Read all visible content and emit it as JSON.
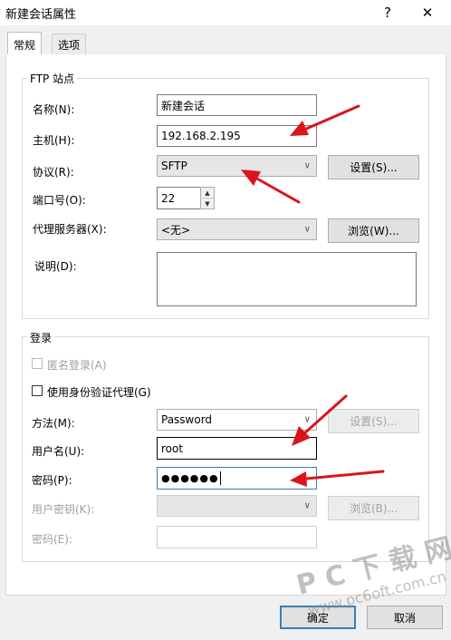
{
  "window": {
    "title": "新建会话属性",
    "help_label": "?",
    "close_label": "✕"
  },
  "tabs": [
    {
      "label": "常规"
    },
    {
      "label": "选项"
    }
  ],
  "ftp_group": {
    "legend": "FTP 站点",
    "name": {
      "label": "名称(N):",
      "value": "新建会话"
    },
    "host": {
      "label": "主机(H):",
      "value": "192.168.2.195"
    },
    "protocol": {
      "label": "协议(R):",
      "value": "SFTP",
      "settings_button": "设置(S)..."
    },
    "port": {
      "label": "端口号(O):",
      "value": "22"
    },
    "proxy": {
      "label": "代理服务器(X):",
      "value": "<无>",
      "browse_button": "浏览(W)..."
    },
    "description": {
      "label": "说明(D):",
      "value": ""
    }
  },
  "login_group": {
    "legend": "登录",
    "anonymous": {
      "label": "匿名登录(A)",
      "checked": false,
      "enabled": false
    },
    "auth_agent": {
      "label": "使用身份验证代理(G)",
      "checked": false
    },
    "method": {
      "label": "方法(M):",
      "value": "Password",
      "settings_button": "设置(S)..."
    },
    "username": {
      "label": "用户名(U):",
      "value": "root"
    },
    "password": {
      "label": "密码(P):",
      "value": "●●●●●●"
    },
    "user_key": {
      "label": "用户密钥(K):",
      "value": "",
      "browse_button": "浏览(B)..."
    },
    "passphrase": {
      "label": "密码(E):",
      "value": ""
    }
  },
  "footer": {
    "ok_button": "确定",
    "cancel_button": "取消"
  },
  "watermark": {
    "text": "P C 下 载 网",
    "url": "www.pc6oft.com.cn"
  },
  "colors": {
    "annotation_arrow": "#d9141c",
    "default_button_border": "#3c7fb1"
  }
}
